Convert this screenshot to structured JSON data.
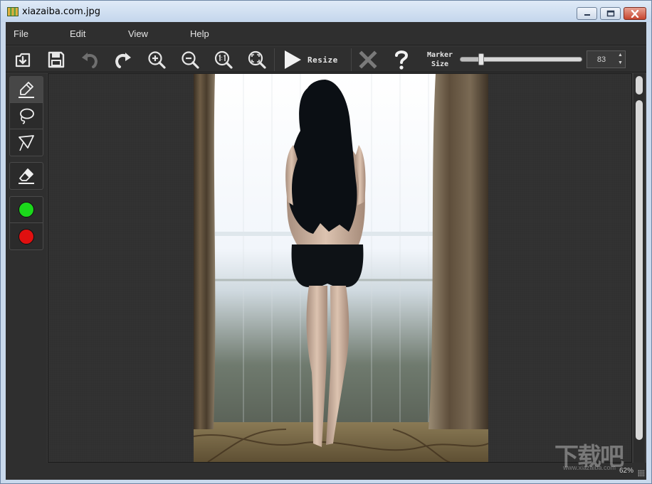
{
  "window": {
    "title": "xiazaiba.com.jpg"
  },
  "menu": [
    "File",
    "Edit",
    "View",
    "Help"
  ],
  "toolbar": {
    "resize_label": "Resize",
    "marker_label_line1": "Marker",
    "marker_label_line2": "Size",
    "marker_size": "83",
    "marker_fraction": 0.17
  },
  "tools": {
    "colors": {
      "keep": "#1bd81b",
      "remove": "#e01010"
    }
  },
  "status": {
    "zoom": "62%"
  },
  "watermark": {
    "main": "下载吧",
    "sub": "www.xiazaiba.com"
  }
}
